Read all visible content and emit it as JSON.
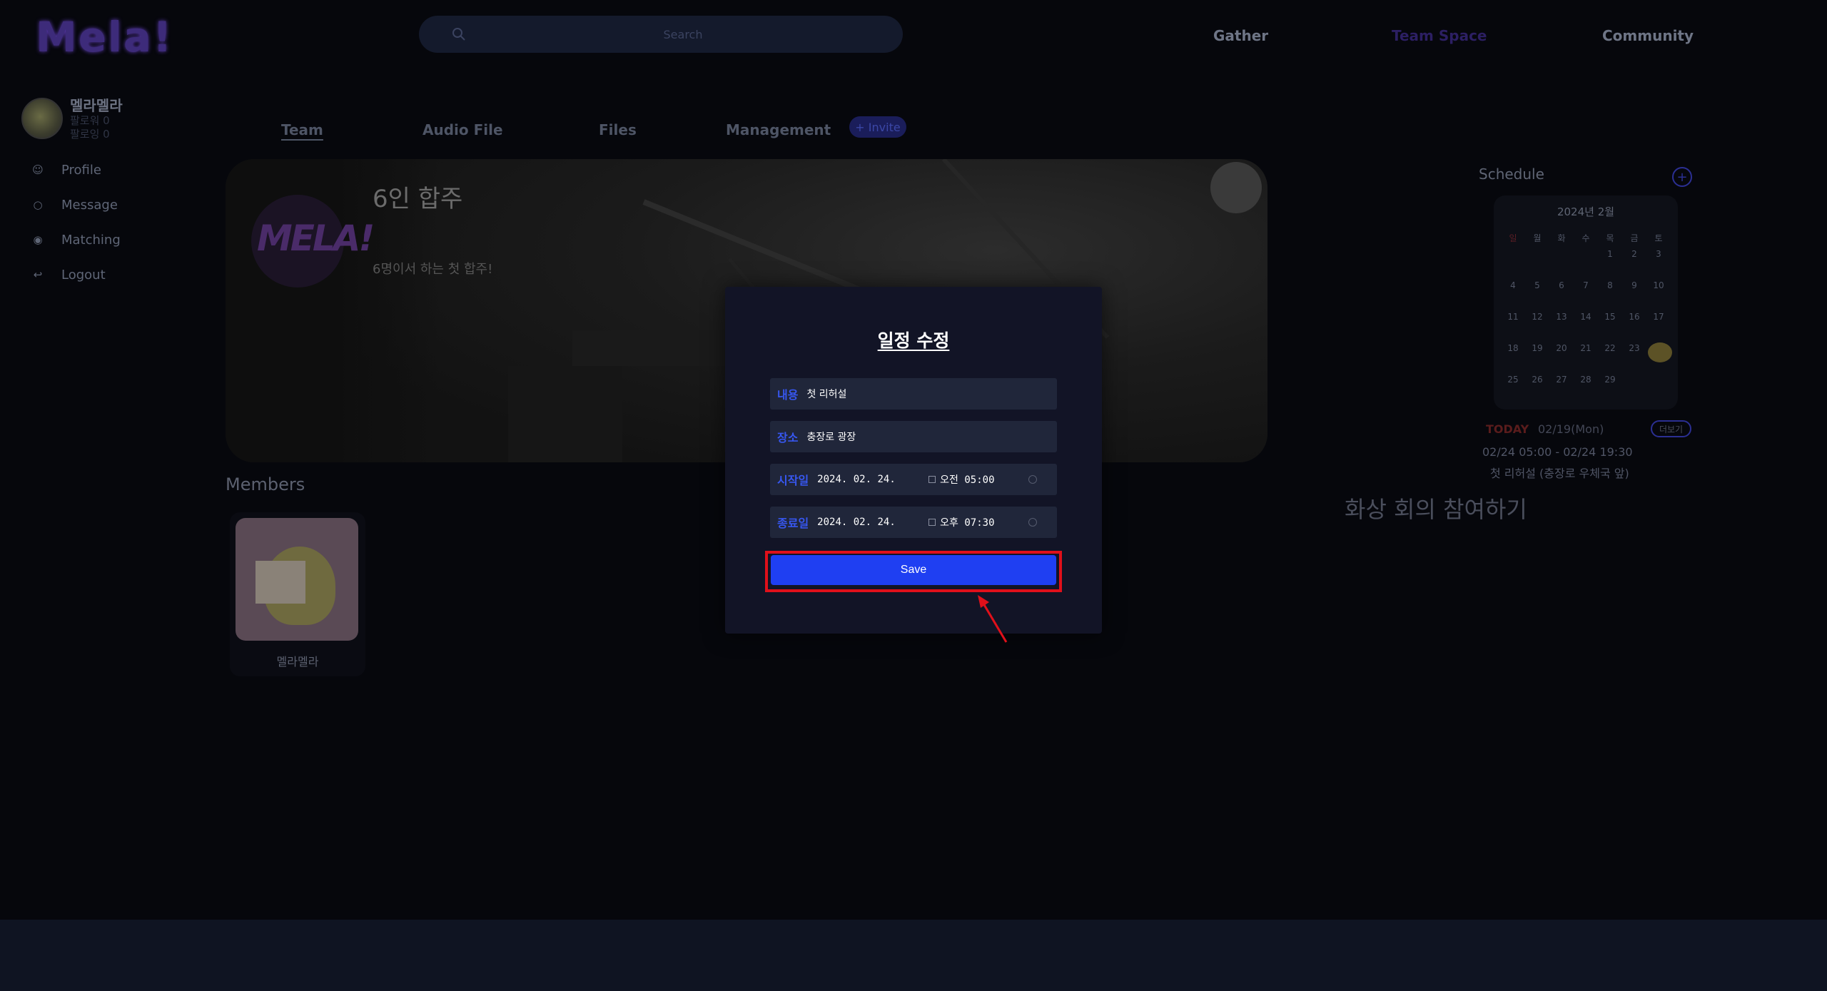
{
  "header": {
    "logo": "Mela!",
    "search_placeholder": "Search",
    "nav": [
      "Gather",
      "Team Space",
      "Community"
    ]
  },
  "sidebar": {
    "username": "멜라멜라",
    "followers": "팔로워 0",
    "following": "팔로잉 0",
    "items": [
      {
        "label": "Profile",
        "icon": "person-icon"
      },
      {
        "label": "Message",
        "icon": "chat-icon"
      },
      {
        "label": "Matching",
        "icon": "matching-icon"
      },
      {
        "label": "Logout",
        "icon": "logout-icon"
      }
    ]
  },
  "tabs": [
    "Team",
    "Audio File",
    "Files",
    "Management"
  ],
  "invite_label": "+ Invite",
  "team": {
    "logo_text": "MELA!",
    "name": "6인 합주",
    "description": "6명이서 하는 첫 합주!"
  },
  "members": {
    "title": "Members",
    "list": [
      {
        "name": "멜라멜라"
      }
    ]
  },
  "schedule": {
    "title": "Schedule",
    "add_label": "+",
    "calendar": {
      "month_label": "2024년 2월",
      "weekdays": [
        "일",
        "월",
        "화",
        "수",
        "목",
        "금",
        "토"
      ],
      "days": [
        [
          "",
          "",
          "",
          "",
          "1",
          "2",
          "3"
        ],
        [
          "4",
          "5",
          "6",
          "7",
          "8",
          "9",
          "10"
        ],
        [
          "11",
          "12",
          "13",
          "14",
          "15",
          "16",
          "17"
        ],
        [
          "18",
          "19",
          "20",
          "21",
          "22",
          "23",
          "24"
        ],
        [
          "25",
          "26",
          "27",
          "28",
          "29",
          "",
          ""
        ]
      ],
      "highlighted_day": "24"
    },
    "today_label": "TODAY",
    "today_date": "02/19(Mon)",
    "more_label": "더보기",
    "event_time": "02/24 05:00 - 02/24 19:30",
    "event_title": "첫 리허설 (충장로 우체국 앞)"
  },
  "video_link": "화상 회의 참여하기",
  "modal": {
    "title": "일정 수정",
    "content_label": "내용",
    "content_value": "첫 리허설",
    "place_label": "장소",
    "place_value": "충장로 광장",
    "start_label": "시작일",
    "start_date": "2024. 02. 24.",
    "start_time": "오전 05:00",
    "end_label": "종료일",
    "end_date": "2024. 02. 24.",
    "end_time": "오후 07:30",
    "save_label": "Save"
  },
  "colors": {
    "background": "#06070c",
    "accent_blue": "#1f3ff2",
    "highlight_red": "#e0101a",
    "label_blue": "#3757f0"
  }
}
